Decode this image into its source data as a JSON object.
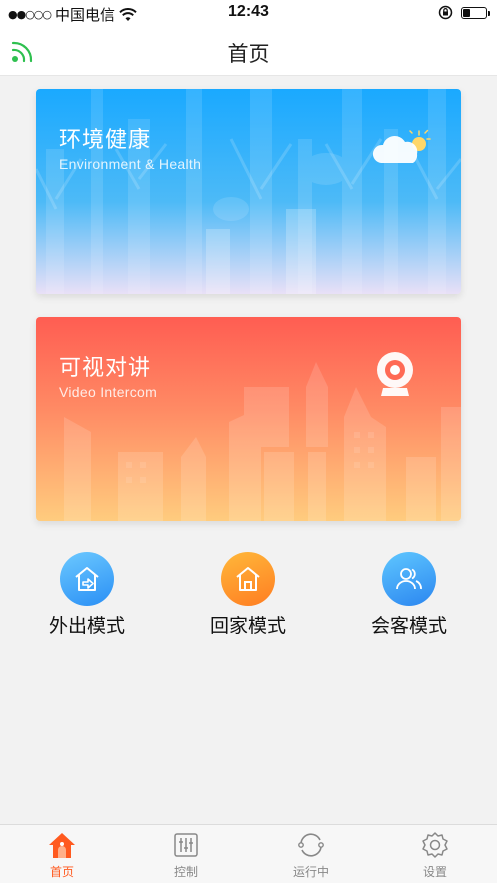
{
  "status_bar": {
    "signal": "●●○○○",
    "carrier": "中国电信",
    "time": "12:43",
    "battery_level": 0.35
  },
  "nav": {
    "title": "首页"
  },
  "cards": {
    "environment": {
      "title": "环境健康",
      "subtitle": "Environment & Health"
    },
    "intercom": {
      "title": "可视对讲",
      "subtitle": "Video Intercom"
    }
  },
  "modes": [
    {
      "label": "外出模式",
      "icon": "leave-home-icon"
    },
    {
      "label": "回家模式",
      "icon": "home-icon"
    },
    {
      "label": "会客模式",
      "icon": "guests-icon"
    }
  ],
  "tabs": [
    {
      "label": "首页",
      "icon": "home-tab-icon",
      "active": true
    },
    {
      "label": "控制",
      "icon": "sliders-icon"
    },
    {
      "label": "运行中",
      "icon": "sync-icon"
    },
    {
      "label": "设置",
      "icon": "gear-icon"
    }
  ],
  "colors": {
    "accent": "#ff5a1f",
    "env_card": "#1aa9ff",
    "intercom_card": "#ff5d52",
    "wifi_green": "#2ec04f"
  }
}
